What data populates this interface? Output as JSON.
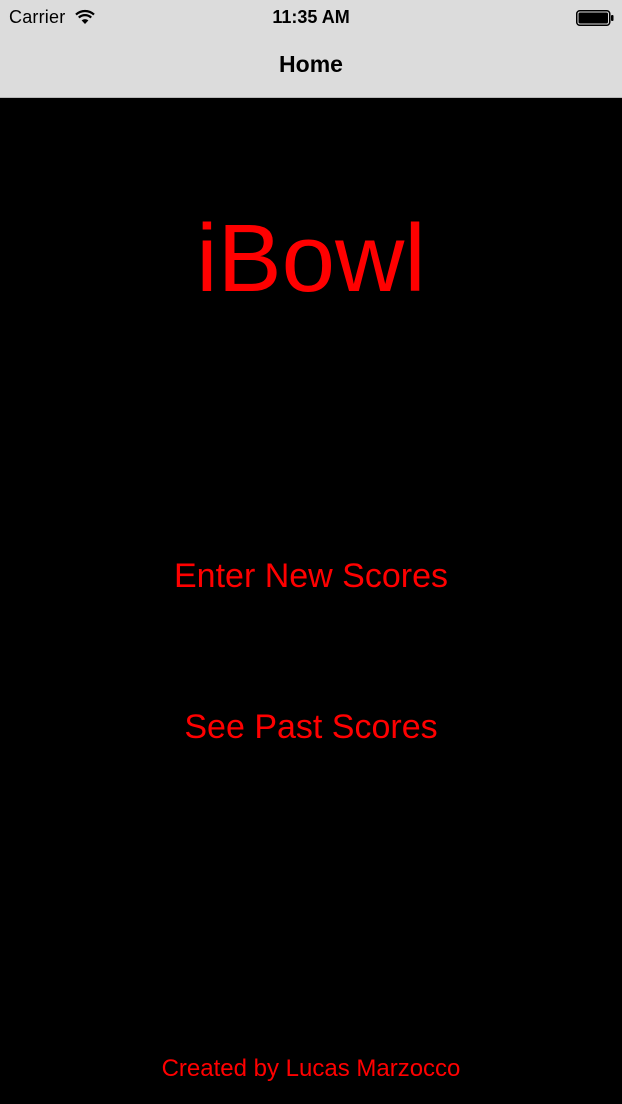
{
  "status_bar": {
    "carrier": "Carrier",
    "time": "11:35 AM",
    "wifi_icon": "wifi-icon",
    "battery_icon": "battery-full-icon"
  },
  "nav_bar": {
    "title": "Home"
  },
  "main": {
    "app_title": "iBowl",
    "enter_scores_label": "Enter New Scores",
    "past_scores_label": "See Past Scores",
    "credit": "Created by Lucas Marzocco"
  },
  "colors": {
    "background": "#000000",
    "accent": "#ff0000",
    "nav_background": "#dcdcdc"
  }
}
